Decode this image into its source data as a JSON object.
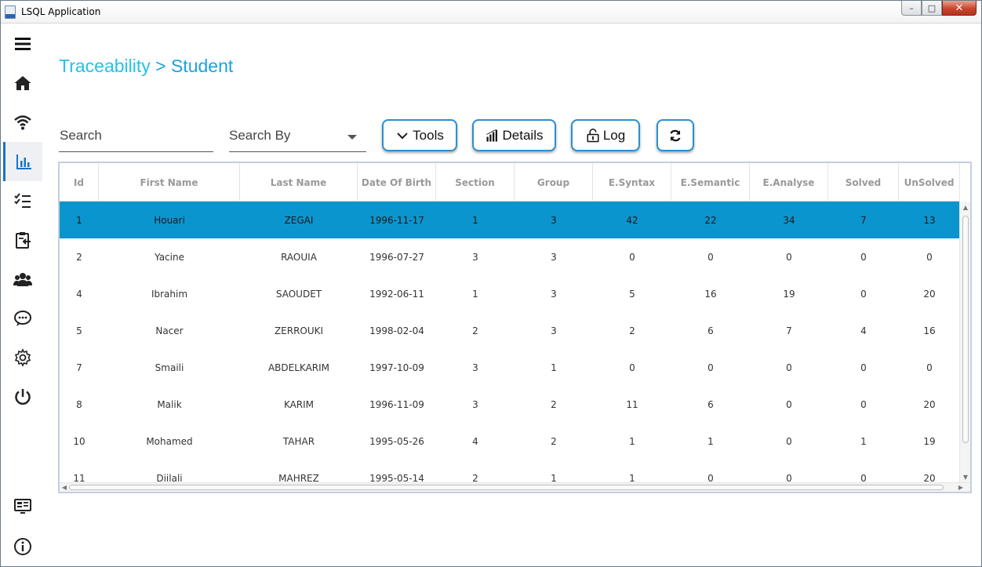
{
  "window": {
    "title": "LSQL Application",
    "minimize": "–",
    "maximize": "□",
    "close": "✕"
  },
  "sidebar": {
    "items": [
      {
        "name": "menu-icon"
      },
      {
        "name": "home-icon"
      },
      {
        "name": "wifi-icon"
      },
      {
        "name": "bar-chart-icon",
        "active": true
      },
      {
        "name": "checklist-icon"
      },
      {
        "name": "clipboard-icon"
      },
      {
        "name": "users-icon"
      },
      {
        "name": "chat-icon"
      },
      {
        "name": "gear-icon"
      },
      {
        "name": "power-icon"
      },
      {
        "name": "dashboard-icon"
      },
      {
        "name": "info-icon"
      }
    ]
  },
  "breadcrumb": {
    "root": "Traceability",
    "separator": ">",
    "current": "Student"
  },
  "toolbar": {
    "search_placeholder": "Search",
    "search_by_label": "Search By",
    "tools_label": "Tools",
    "details_label": "Details",
    "log_label": "Log"
  },
  "table": {
    "columns": [
      "Id",
      "First Name",
      "Last Name",
      "Date Of Birth",
      "Section",
      "Group",
      "E.Syntax",
      "E.Semantic",
      "E.Analyse",
      "Solved",
      "UnSolved"
    ],
    "rows": [
      [
        "1",
        "Houari",
        "ZEGAI",
        "1996-11-17",
        "1",
        "3",
        "42",
        "22",
        "34",
        "7",
        "13"
      ],
      [
        "2",
        "Yacine",
        "RAOUIA",
        "1996-07-27",
        "3",
        "3",
        "0",
        "0",
        "0",
        "0",
        "0"
      ],
      [
        "4",
        "Ibrahim",
        "SAOUDET",
        "1992-06-11",
        "1",
        "3",
        "5",
        "16",
        "19",
        "0",
        "20"
      ],
      [
        "5",
        "Nacer",
        "ZERROUKI",
        "1998-02-04",
        "2",
        "3",
        "2",
        "6",
        "7",
        "4",
        "16"
      ],
      [
        "7",
        "Smaili",
        "ABDELKARIM",
        "1997-10-09",
        "3",
        "1",
        "0",
        "0",
        "0",
        "0",
        "0"
      ],
      [
        "8",
        "Malik",
        "KARIM",
        "1996-11-09",
        "3",
        "2",
        "11",
        "6",
        "0",
        "0",
        "20"
      ],
      [
        "10",
        "Mohamed",
        "TAHAR",
        "1995-05-26",
        "4",
        "2",
        "1",
        "1",
        "0",
        "1",
        "19"
      ],
      [
        "11",
        "Djilali",
        "MAHREZ",
        "1995-05-14",
        "2",
        "1",
        "1",
        "0",
        "0",
        "0",
        "20"
      ]
    ],
    "selected_row": 0
  },
  "colors": {
    "accent": "#1aa3e0",
    "selected_row": "#0b95cf",
    "button_border": "#2b8fd0"
  }
}
